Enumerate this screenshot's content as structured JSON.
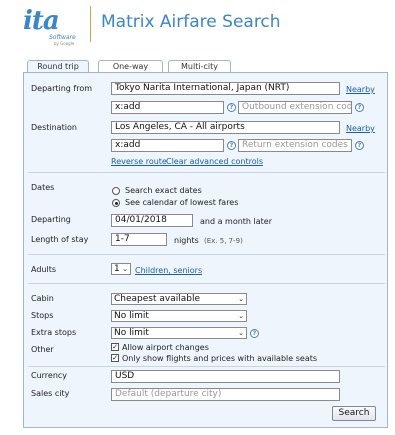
{
  "header": {
    "logo_text": "ita",
    "logo_sub": "Software",
    "logo_by": "by Google",
    "title": "Matrix Airfare Search"
  },
  "tabs": [
    {
      "label": "Round trip",
      "active": true
    },
    {
      "label": "One-way",
      "active": false
    },
    {
      "label": "Multi-city",
      "active": false
    }
  ],
  "form": {
    "departing_from_label": "Departing from",
    "departing_from_value": "Tokyo Narita International, Japan (NRT)",
    "nearby_label": "Nearby",
    "outbound_code_value": "x:add",
    "outbound_ext_placeholder": "Outbound extension codes",
    "destination_label": "Destination",
    "destination_value": "Los Angeles, CA - All airports",
    "return_code_value": "x:add",
    "return_ext_placeholder": "Return extension codes",
    "reverse_route": "Reverse route",
    "clear_advanced": "Clear advanced controls",
    "help_glyph": "?",
    "dates_label": "Dates",
    "exact_dates": "Search exact dates",
    "calendar_dates": "See calendar of lowest fares",
    "departing_label": "Departing",
    "departing_value": "04/01/2018",
    "departing_suffix": "and a month later",
    "length_label": "Length of stay",
    "length_value": "1-7",
    "nights_label": "nights",
    "nights_hint": "(Ex. 5, 7-9)",
    "adults_label": "Adults",
    "adults_value": "1",
    "children_link": "Children, seniors",
    "cabin_label": "Cabin",
    "cabin_value": "Cheapest available",
    "stops_label": "Stops",
    "stops_value": "No limit",
    "extra_stops_label": "Extra stops",
    "extra_stops_value": "No limit",
    "other_label": "Other",
    "allow_airport_changes": "Allow airport changes",
    "only_available": "Only show flights and prices with available seats",
    "currency_label": "Currency",
    "currency_value": "USD",
    "sales_city_label": "Sales city",
    "sales_city_placeholder": "Default (departure city)",
    "search_button": "Search"
  },
  "colors": {
    "brand_blue": "#3a86c8",
    "divider_orange": "#e69a4a",
    "panel_bg": "#eef5fc",
    "link": "#1a5fa8"
  }
}
